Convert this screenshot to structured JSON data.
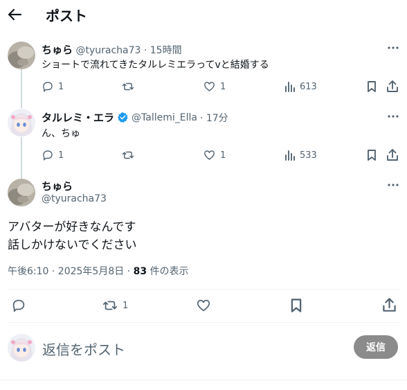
{
  "header": {
    "title": "ポスト"
  },
  "replies": [
    {
      "name": "ちゅら",
      "handle": "@tyuracha73",
      "time": "· 15時間",
      "text": "ショートで流れてきたタルレミエラってvと結婚する",
      "stats": {
        "replies": "1",
        "reposts": "",
        "likes": "1",
        "views": "613"
      },
      "avatar": "photo-avatar"
    },
    {
      "name": "タルレミ・エラ",
      "verified": true,
      "handle": "@Tallemi_Ella",
      "time": "· 17分",
      "text": "ん、ちゅ",
      "stats": {
        "replies": "1",
        "reposts": "",
        "likes": "1",
        "views": "533"
      },
      "avatar": "anime-girl-avatar"
    }
  ],
  "main_post": {
    "name": "ちゅら",
    "handle": "@tyuracha73",
    "text_line1": "アバターが好きなんです",
    "text_line2": "話しかけないでください",
    "timestamp": "午後6:10 · 2025年5月8日 · ",
    "views_count": "83",
    "views_label": " 件の表示",
    "actions": {
      "replies": "",
      "reposts": "1",
      "likes": "",
      "bookmarks": ""
    }
  },
  "composer": {
    "placeholder": "返信をポスト",
    "button": "返信"
  },
  "colors": {
    "accent": "#1d9bf0",
    "muted": "#536471",
    "thread_line": "#cfd9de",
    "button_bg": "#8b8b8b"
  }
}
